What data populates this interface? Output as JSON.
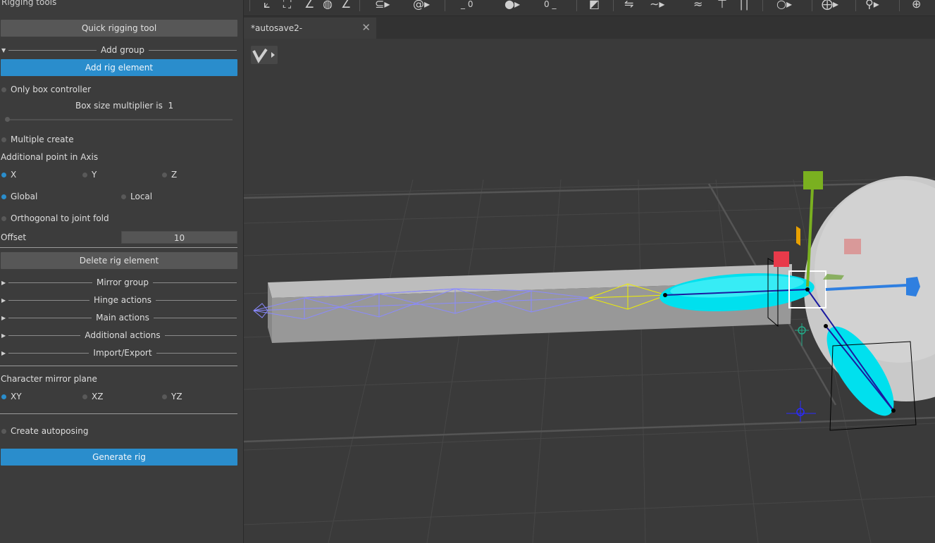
{
  "panel": {
    "title": "Rigging tools",
    "quick_btn": "Quick rigging tool",
    "add_group": "Add group",
    "add_rig": "Add rig element",
    "only_box": "Only box controller",
    "box_mult_label": "Box size multiplier is",
    "box_mult_value": "1",
    "multiple_create": "Multiple create",
    "additional_point": "Additional point in Axis",
    "axis_x": "X",
    "axis_y": "Y",
    "axis_z": "Z",
    "global": "Global",
    "local": "Local",
    "orthogonal": "Orthogonal to joint fold",
    "offset_label": "Offset",
    "offset_value": "10",
    "delete_rig": "Delete rig element",
    "groups": [
      "Mirror group",
      "Hinge actions",
      "Main actions",
      "Additional actions",
      "Import/Export"
    ],
    "mirror_plane": "Character mirror plane",
    "plane_xy": "XY",
    "plane_xz": "XZ",
    "plane_yz": "YZ",
    "autoposing": "Create autoposing",
    "generate": "Generate rig"
  },
  "toolbar": {
    "field_a": "0",
    "field_b": "0"
  },
  "tab": {
    "label": "*autosave2-",
    "close": "✕"
  },
  "colors": {
    "accent": "#2a8dcc",
    "panel_bg": "#3c3c3c",
    "viewport_bg": "#3a3a3a",
    "bone_cyan": "#00e5f0",
    "joint_yellow": "#f0f000",
    "chain_blue": "#7b7bff",
    "gizmo_green": "#7ab020",
    "gizmo_red": "#e83a4a",
    "gizmo_blue": "#2f7fe0"
  }
}
